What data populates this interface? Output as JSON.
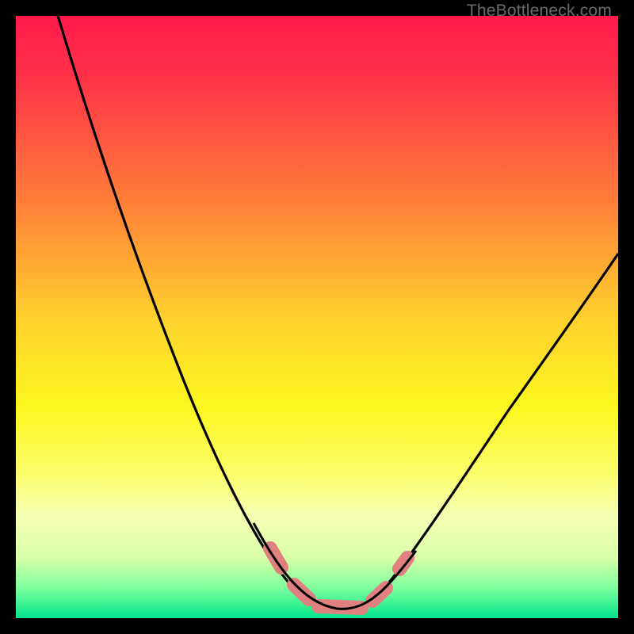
{
  "watermark": {
    "text": "TheBottleneck.com"
  },
  "chart_data": {
    "type": "line",
    "title": "",
    "xlabel": "",
    "ylabel": "",
    "xlim": [
      0,
      100
    ],
    "ylim": [
      0,
      100
    ],
    "grid": false,
    "legend": false,
    "background_gradient": {
      "stops": [
        {
          "offset": 0.0,
          "color": "#ff1a4b"
        },
        {
          "offset": 0.1,
          "color": "#ff3249"
        },
        {
          "offset": 0.3,
          "color": "#ff7b3a"
        },
        {
          "offset": 0.5,
          "color": "#ffd02d"
        },
        {
          "offset": 0.65,
          "color": "#fcf720"
        },
        {
          "offset": 0.76,
          "color": "#fbff6b"
        },
        {
          "offset": 0.83,
          "color": "#f6ffb4"
        },
        {
          "offset": 0.9,
          "color": "#d9ffa9"
        },
        {
          "offset": 0.95,
          "color": "#7dff9c"
        },
        {
          "offset": 1.0,
          "color": "#00e58e"
        }
      ]
    },
    "series": [
      {
        "name": "bottleneck-curve",
        "x": [
          7,
          10,
          15,
          20,
          25,
          30,
          35,
          40,
          45,
          48,
          50,
          52,
          55,
          58,
          60,
          65,
          70,
          75,
          80,
          85,
          90,
          95,
          100
        ],
        "y": [
          100,
          92,
          80,
          67,
          55,
          43,
          32,
          22,
          12,
          7,
          4,
          2,
          1,
          1,
          2,
          7,
          14,
          22,
          30,
          38,
          45,
          52,
          58
        ]
      }
    ],
    "annotations": {
      "trough_markers": {
        "color": "#e08080",
        "segments": [
          {
            "x1": 42,
            "y1": 13,
            "x2": 44,
            "y2": 9
          },
          {
            "x1": 46,
            "y1": 6,
            "x2": 49,
            "y2": 3
          },
          {
            "x1": 50,
            "y1": 2,
            "x2": 58,
            "y2": 2
          },
          {
            "x1": 59,
            "y1": 3,
            "x2": 61,
            "y2": 5
          },
          {
            "x1": 63,
            "y1": 8,
            "x2": 64,
            "y2": 10
          }
        ]
      }
    }
  }
}
